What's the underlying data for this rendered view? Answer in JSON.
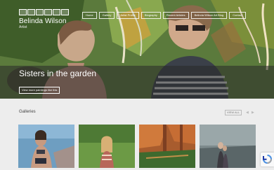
{
  "brand": {
    "name": "Belinda Wilson",
    "subtitle": "Artist"
  },
  "nav": {
    "items": [
      {
        "label": "Home"
      },
      {
        "label": "Gallery"
      },
      {
        "label": "Artist Profile"
      },
      {
        "label": "Biography"
      },
      {
        "label": "Recent Articles"
      },
      {
        "label": "Belinda Wilson Art Blog"
      },
      {
        "label": "Contact"
      }
    ]
  },
  "hero": {
    "title": "Sisters in the garden",
    "button_label": "View more paintings like this"
  },
  "galleries": {
    "title": "Galleries",
    "view_all_label": "VIEW ALL",
    "prev_icon": "chevron-left-icon",
    "next_icon": "chevron-right-icon"
  },
  "colors": {
    "page_bg": "#ededed",
    "hero_band": "#3a3a3a",
    "nav_border": "#ffffff"
  }
}
